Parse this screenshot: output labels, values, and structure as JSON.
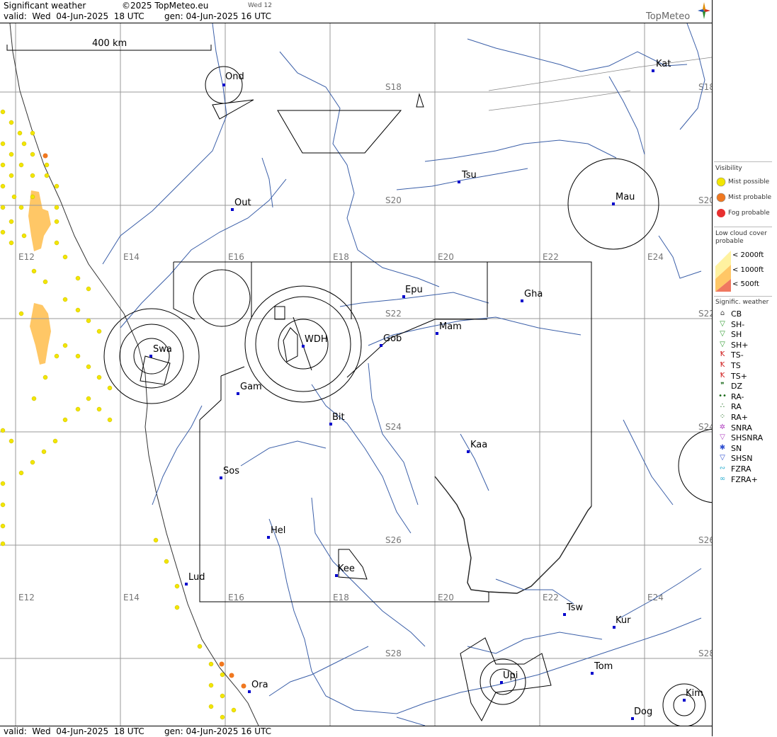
{
  "header": {
    "title": "Significant weather",
    "copyright": "©2025 TopMeteo.eu",
    "day_tab": "Wed 12",
    "valid": "valid:  Wed  04-Jun-2025  18 UTC",
    "generated": "gen: 04-Jun-2025 16 UTC",
    "brand": "TopMeteo"
  },
  "footer": {
    "valid": "valid:  Wed  04-Jun-2025  18 UTC",
    "generated": "gen: 04-Jun-2025 16 UTC"
  },
  "map": {
    "scale_label": "400 km",
    "longitude_labels": [
      "E12",
      "E14",
      "E16",
      "E18",
      "E20",
      "E22",
      "E24"
    ],
    "latitude_labels": [
      "S18",
      "S20",
      "S22",
      "S24",
      "S26",
      "S28"
    ],
    "places": [
      "Ond",
      "Kat",
      "Tsu",
      "Out",
      "Mau",
      "Epu",
      "Gha",
      "Mam",
      "Gob",
      "WDH",
      "Swa",
      "Gam",
      "Bit",
      "Kaa",
      "Sos",
      "Hel",
      "Lud",
      "Kee",
      "Tsw",
      "Kur",
      "Tom",
      "Upi",
      "Ora",
      "Kim",
      "Dog"
    ],
    "colors": {
      "mist": "#f2e600",
      "mist_probable": "#f07820",
      "fog": "#e83030",
      "low_cloud": "#ffc766",
      "river": "#3b5fa8",
      "place": "#0000cc"
    }
  },
  "legend": {
    "visibility": {
      "title": "Visibility",
      "items": [
        "Mist possible",
        "Mist probable",
        "Fog probable"
      ]
    },
    "low_cloud": {
      "title": "Low cloud cover probable",
      "items": [
        "< 2000ft",
        "< 1000ft",
        "<   500ft"
      ]
    },
    "weather": {
      "title": "Signific. weather",
      "items": [
        {
          "label": "CB",
          "icon": "cb-icon",
          "color": "#444444"
        },
        {
          "label": "SH-",
          "icon": "shower-light-icon",
          "color": "#2e9a2e"
        },
        {
          "label": "SH",
          "icon": "shower-icon",
          "color": "#2e9a2e"
        },
        {
          "label": "SH+",
          "icon": "shower-heavy-icon",
          "color": "#2e9a2e"
        },
        {
          "label": "TS-",
          "icon": "thunderstorm-light-icon",
          "color": "#d02020"
        },
        {
          "label": "TS",
          "icon": "thunderstorm-icon",
          "color": "#d02020"
        },
        {
          "label": "TS+",
          "icon": "thunderstorm-heavy-icon",
          "color": "#d02020"
        },
        {
          "label": "DZ",
          "icon": "drizzle-icon",
          "color": "#1a6a1a"
        },
        {
          "label": "RA-",
          "icon": "rain-light-icon",
          "color": "#1a6a1a"
        },
        {
          "label": "RA",
          "icon": "rain-icon",
          "color": "#1a6a1a"
        },
        {
          "label": "RA+",
          "icon": "rain-heavy-icon",
          "color": "#1a6a1a"
        },
        {
          "label": "SNRA",
          "icon": "sleet-icon",
          "color": "#b040c0"
        },
        {
          "label": "SHSNRA",
          "icon": "sleet-shower-icon",
          "color": "#b040c0"
        },
        {
          "label": "SN",
          "icon": "snow-icon",
          "color": "#3050d0"
        },
        {
          "label": "SHSN",
          "icon": "snow-shower-icon",
          "color": "#3050d0"
        },
        {
          "label": "FZRA",
          "icon": "freezing-rain-icon",
          "color": "#30b0d0"
        },
        {
          "label": "FZRA+",
          "icon": "freezing-rain-heavy-icon",
          "color": "#30b0d0"
        }
      ]
    }
  }
}
